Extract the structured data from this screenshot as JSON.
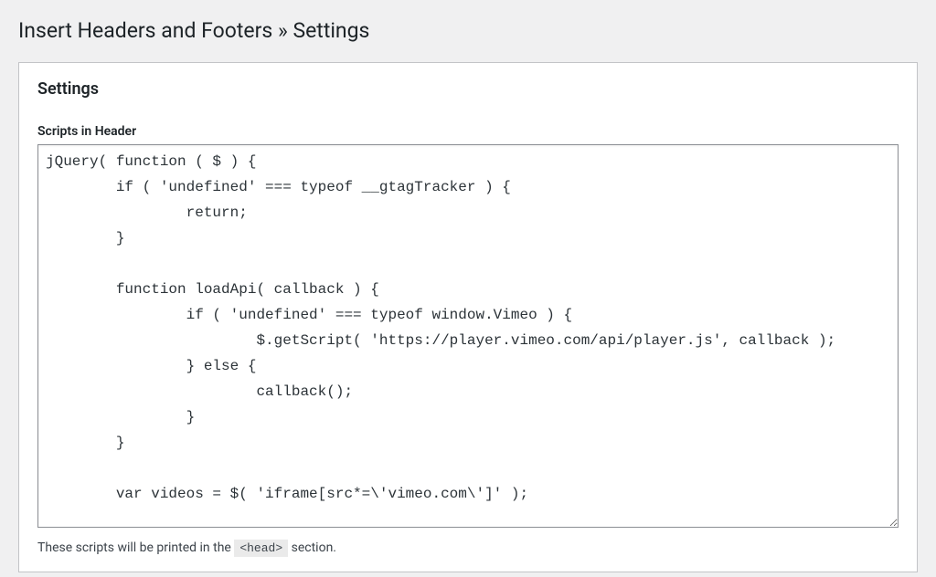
{
  "page": {
    "title": "Insert Headers and Footers » Settings"
  },
  "box": {
    "heading": "Settings"
  },
  "header_scripts": {
    "label": "Scripts in Header",
    "value": "jQuery( function ( $ ) {\n        if ( 'undefined' === typeof __gtagTracker ) {\n                return;\n        }\n\n        function loadApi( callback ) {\n                if ( 'undefined' === typeof window.Vimeo ) {\n                        $.getScript( 'https://player.vimeo.com/api/player.js', callback );\n                } else {\n                        callback();\n                }\n        }\n\n        var videos = $( 'iframe[src*=\\'vimeo.com\\']' );",
    "helper_prefix": "These scripts will be printed in the ",
    "helper_tag": "<head>",
    "helper_suffix": " section."
  }
}
